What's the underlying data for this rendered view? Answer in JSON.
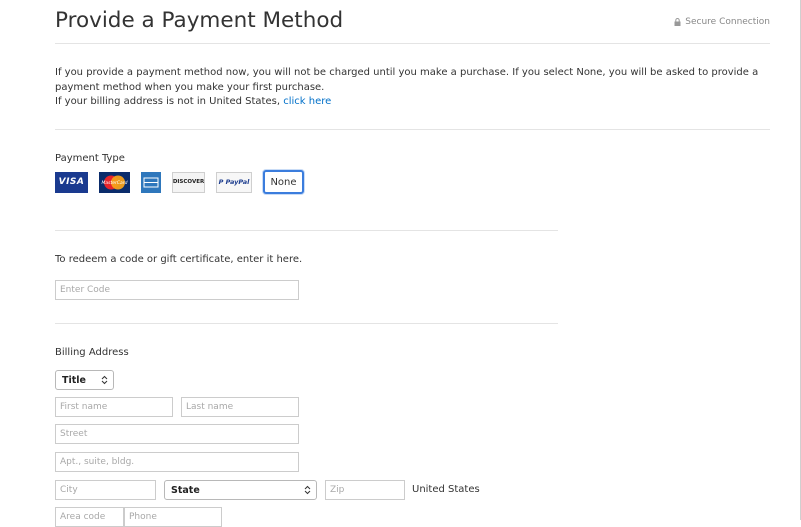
{
  "header": {
    "title": "Provide a Payment Method",
    "secure_label": "Secure Connection"
  },
  "intro": {
    "line1": "If you provide a payment method now, you will not be charged until you make a purchase. If you select None, you will be asked to provide a payment method when you make your first purchase.",
    "line2_prefix": "If your billing address is not in United States, ",
    "line2_link": "click here"
  },
  "payment": {
    "label": "Payment Type",
    "options": [
      {
        "name": "visa",
        "label": "VISA",
        "icon": "visa-logo"
      },
      {
        "name": "mastercard",
        "label": "MasterCard",
        "icon": "mastercard-logo"
      },
      {
        "name": "amex",
        "label": "",
        "icon": "amex-logo"
      },
      {
        "name": "discover",
        "label": "DISCOVER",
        "icon": "discover-logo"
      },
      {
        "name": "paypal",
        "label": "P PayPal",
        "icon": "paypal-logo"
      },
      {
        "name": "none",
        "label": "None",
        "selected": true
      }
    ]
  },
  "redeem": {
    "label": "To redeem a code or gift certificate, enter it here.",
    "placeholder": "Enter Code"
  },
  "billing": {
    "label": "Billing Address",
    "title_select": "Title",
    "first_name_placeholder": "First name",
    "last_name_placeholder": "Last name",
    "street_placeholder": "Street",
    "apt_placeholder": "Apt., suite, bldg.",
    "city_placeholder": "City",
    "state_select": "State",
    "zip_placeholder": "Zip",
    "country": "United States",
    "area_code_placeholder": "Area code",
    "phone_placeholder": "Phone"
  },
  "colors": {
    "link": "#0070c9",
    "selected_border": "#3b7ddd",
    "visa": "#1a3a8f",
    "amex": "#2e77bc"
  }
}
